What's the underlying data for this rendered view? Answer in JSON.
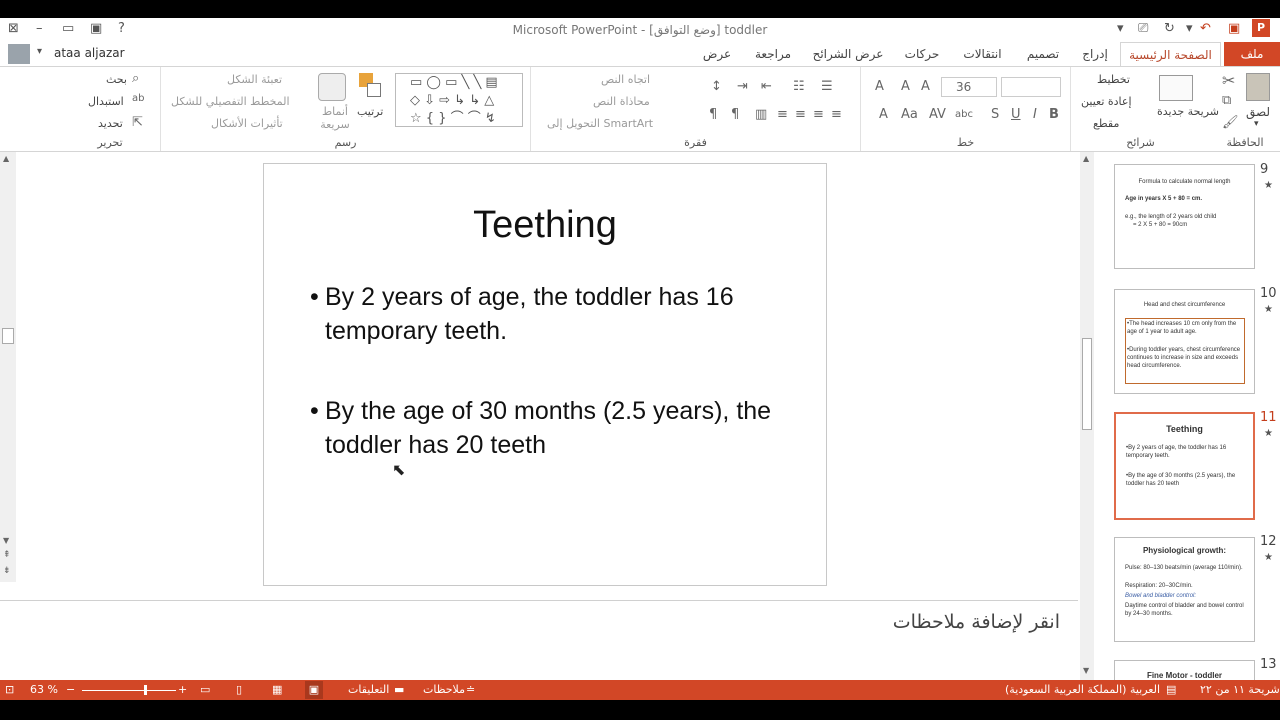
{
  "window": {
    "title": "Microsoft PowerPoint - [وضع التوافق] toddler",
    "user": "ataa aljazar"
  },
  "tabs": [
    "ملف",
    "الصفحة الرئيسية",
    "إدراج",
    "تصميم",
    "انتقالات",
    "حركات",
    "عرض الشرائح",
    "مراجعة",
    "عرض"
  ],
  "ribbon": {
    "clipboard": {
      "label": "الحافظة",
      "paste": "لصق"
    },
    "slides": {
      "label": "شرائح",
      "new_slide": "شريحة جديدة",
      "layout": "تخطيط",
      "reset": "إعادة تعيين",
      "section": "مقطع"
    },
    "font": {
      "label": "خط",
      "size": "36",
      "bold": "B",
      "italic": "I",
      "underline": "U",
      "strike": "S",
      "shadow": "abc"
    },
    "paragraph": {
      "label": "فقرة",
      "text_direction": "اتجاه النص",
      "align_text": "محاذاة النص",
      "smartart": "التحويل إلى SmartArt"
    },
    "drawing": {
      "label": "رسم",
      "arrange": "ترتيب",
      "quick_styles": "أنماط سريعة",
      "shape_fill": "تعبئة الشكل",
      "shape_outline": "المخطط التفصيلي للشكل",
      "shape_effects": "تأثيرات الأشكال"
    },
    "editing": {
      "label": "تحرير",
      "find": "بحث",
      "replace": "استبدال",
      "select": "تحديد"
    }
  },
  "slide": {
    "title": "Teething",
    "bullets": [
      "By 2 years of age, the toddler has 16 temporary teeth.",
      "By the age of 30 months (2.5 years), the toddler has 20 teeth"
    ]
  },
  "notes_placeholder": "انقر لإضافة ملاحظات",
  "thumbnails": [
    {
      "num": "9",
      "title": "Formula to calculate normal length",
      "lines": [
        "Age in years X 5 + 80 =        cm.",
        "e.g., the length of 2 years old child",
        "= 2 X 5 + 80 = 90cm"
      ]
    },
    {
      "num": "10",
      "title": "Head and chest circumference",
      "lines": [
        "•The head increases 10 cm only from the age of 1 year to adult age.",
        "•During toddler years, chest circumference continues to increase in size and exceeds head circumference."
      ]
    },
    {
      "num": "11",
      "title": "Teething",
      "lines": [
        "•By 2 years of age, the toddler has 16 temporary teeth.",
        "•By the age of 30 months (2.5 years), the toddler has 20 teeth"
      ]
    },
    {
      "num": "12",
      "title": "Physiological growth:",
      "lines": [
        "Pulse: 80–130 beats/min (average 110/min).",
        "Respiration: 20–30C/min.",
        "Bowel and bladder control:",
        "Daytime control of bladder and bowel control by 24–30 months."
      ]
    },
    {
      "num": "13",
      "title": "Fine Motor - toddler",
      "lines": []
    }
  ],
  "status": {
    "slide_info": "شريحة ١١ من ٢٢",
    "language": "العربية (المملكة العربية السعودية)",
    "notes": "ملاحظات",
    "comments": "التعليقات",
    "zoom": "63 %"
  },
  "colors": {
    "accent": "#d24726",
    "selected_thumb": "#e06b4a"
  }
}
